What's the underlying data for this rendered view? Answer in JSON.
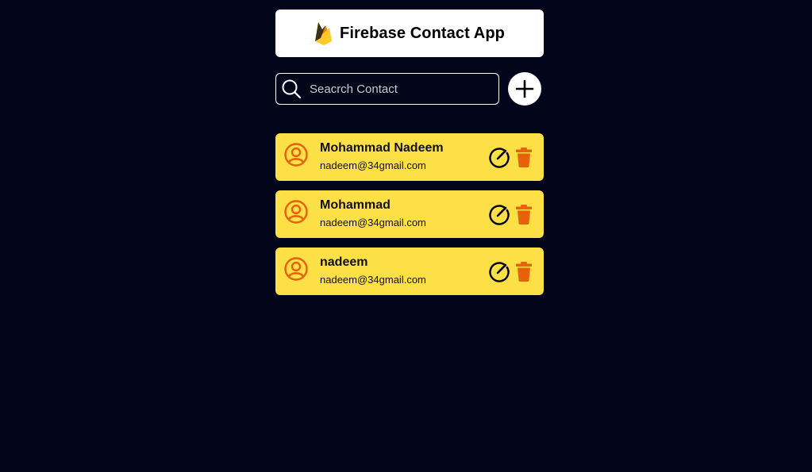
{
  "header": {
    "title": "Firebase Contact App",
    "logo_icon": "firebase-flame-icon"
  },
  "search": {
    "placeholder": "Seacrch Contact",
    "value": "",
    "icon": "search-icon"
  },
  "add_button": {
    "icon": "plus-icon"
  },
  "contacts": [
    {
      "name": "Mohammad Nadeem",
      "email": "nadeem@34gmail.com"
    },
    {
      "name": "Mohammad",
      "email": "nadeem@34gmail.com"
    },
    {
      "name": "nadeem",
      "email": "nadeem@34gmail.com"
    }
  ],
  "colors": {
    "background": "#03051a",
    "card": "#fddf46",
    "accent": "#e8600c"
  }
}
